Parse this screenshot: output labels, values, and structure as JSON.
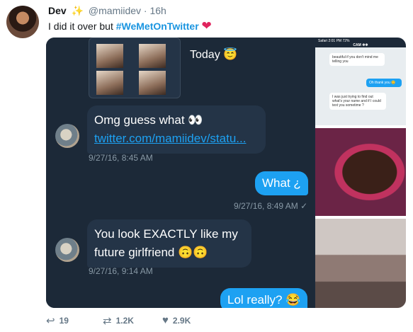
{
  "tweet": {
    "name": "Dev",
    "handle": "@mamiidev",
    "separator": "·",
    "time": "16h",
    "text": "I did it over but",
    "hashtag": "#WeMetOnTwitter"
  },
  "chat": {
    "today_label": "Today 😇",
    "messages": [
      {
        "side": "in",
        "text": "Omg guess what 👀",
        "link": "twitter.com/mamiidev/statu...",
        "time": "9/27/16, 8:45 AM"
      },
      {
        "side": "out",
        "text": "What ¿",
        "time": "9/27/16, 8:49 AM ✓"
      },
      {
        "side": "in",
        "text": "You look EXACTLY like my future girlfriend 🙃🙃",
        "time": "9/27/16, 9:14 AM"
      },
      {
        "side": "out",
        "text": "Lol really? 😂"
      }
    ]
  },
  "side_shot": {
    "status": "Safari  2:01 PM  72%",
    "contact": "CAM ❄❄",
    "messages": [
      {
        "side": "in",
        "text": "beautiful if you don't mind me telling you"
      },
      {
        "side": "out",
        "text": "Oh thank you 😊"
      },
      {
        "side": "in",
        "text": "I was just trying to find out what's your name and if I could text you sometime ?"
      }
    ]
  },
  "actions": {
    "replies": "19",
    "retweets": "1.2K",
    "likes": "2.9K"
  },
  "colors": {
    "brand": "#1da1f2",
    "chat_bg": "#1c2938",
    "like": "#e0245e"
  }
}
